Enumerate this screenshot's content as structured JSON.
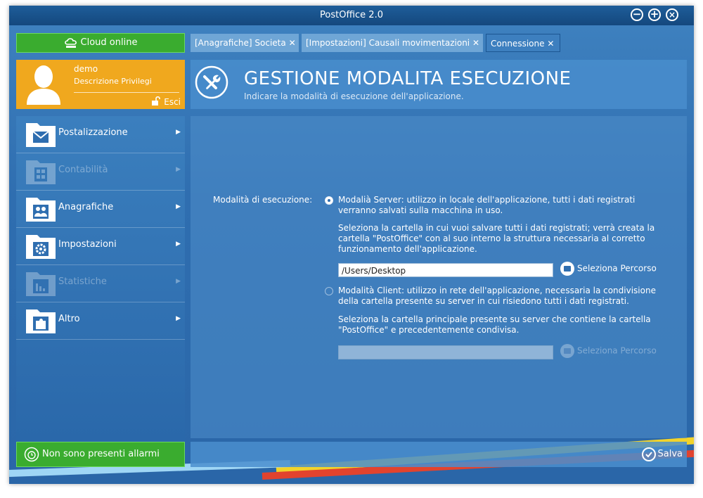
{
  "window": {
    "title": "PostOffice 2.0"
  },
  "cloud": {
    "label": "Cloud online"
  },
  "user": {
    "name": "demo",
    "privileges": "Descrizione Privilegi",
    "logout": "Esci"
  },
  "menu": [
    {
      "label": "Postalizzazione",
      "icon": "envelope-icon",
      "enabled": true
    },
    {
      "label": "Contabilità",
      "icon": "calculator-icon",
      "enabled": false
    },
    {
      "label": "Anagrafiche",
      "icon": "users-icon",
      "enabled": true
    },
    {
      "label": "Impostazioni",
      "icon": "gear-icon",
      "enabled": true
    },
    {
      "label": "Statistiche",
      "icon": "bar-chart-icon",
      "enabled": false
    },
    {
      "label": "Altro",
      "icon": "puzzle-icon",
      "enabled": true
    }
  ],
  "alarm": {
    "label": "Non sono presenti allarmi"
  },
  "tabs": [
    {
      "label": "[Anagrafiche] Societa",
      "active": false
    },
    {
      "label": "[Impostazioni] Causali movimentazioni",
      "active": false
    },
    {
      "label": "Connessione",
      "active": true
    }
  ],
  "tab_close": "✕",
  "header": {
    "title": "GESTIONE MODALITA ESECUZIONE",
    "subtitle": "Indicare la modalità di esecuzione dell'applicazione."
  },
  "form": {
    "label": "Modalità di esecuzione:",
    "server": {
      "selected": true,
      "line1": "Modalià Server: utilizzo in locale dell'applicazione, tutti i dati registrati",
      "line2": "verranno salvati sulla macchina in uso.",
      "help": "Seleziona la cartella in cui vuoi salvare tutti i dati registrati; verrà creata la cartella \"PostOffice\" con al suo interno la struttura necessaria al corretto funzionamento dell'applicazione.",
      "path": "/Users/Desktop",
      "browse": "Seleziona Percorso"
    },
    "client": {
      "selected": false,
      "line1": "Modalità Client: utilizzo in rete dell'applicazione, necessaria la condivisione",
      "line2": "della cartella presente su server in cui risiedono tutti i dati registrati.",
      "help": "Seleziona la cartella principale presente su server che contiene la cartella \"PostOffice\" e precedentemente condivisa.",
      "path": "",
      "browse": "Seleziona Percorso"
    }
  },
  "footer": {
    "save": "Salva"
  },
  "colors": {
    "accent_green": "#3aac2f",
    "user_orange": "#f0a81e",
    "window_blue": "#2f6eb0"
  }
}
